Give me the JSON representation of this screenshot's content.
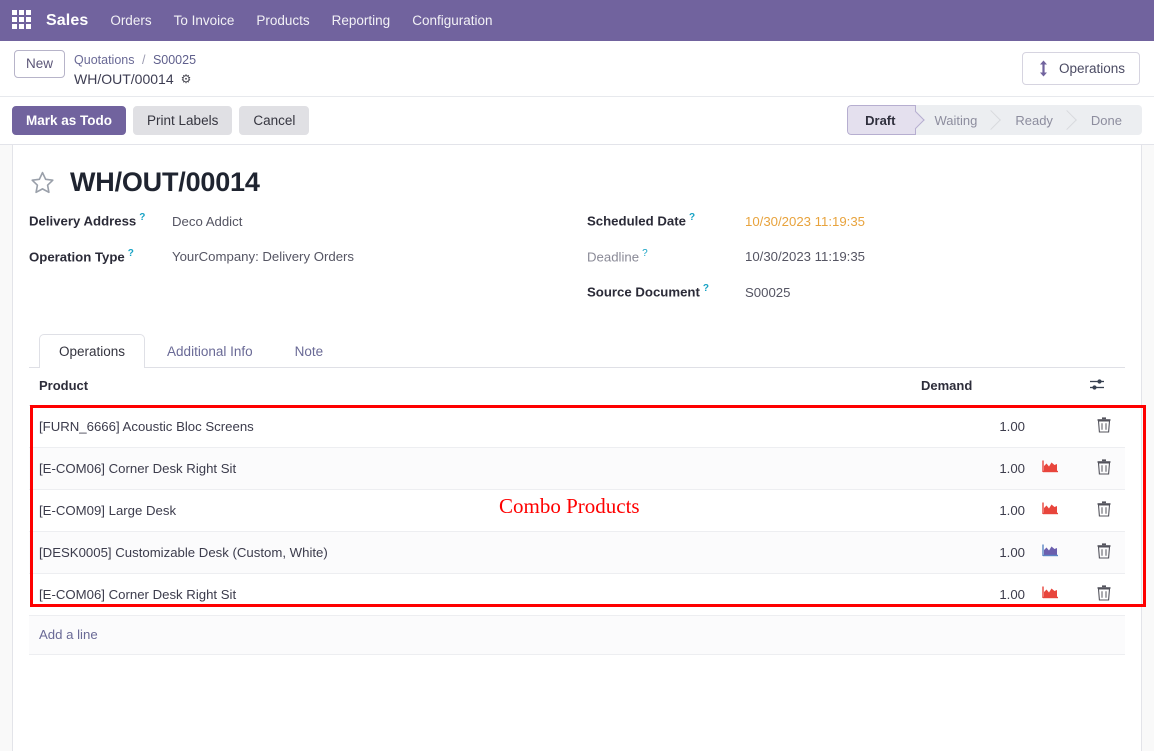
{
  "navbar": {
    "apps_icon": "apps-grid-icon",
    "brand": "Sales",
    "items": [
      {
        "label": "Orders"
      },
      {
        "label": "To Invoice"
      },
      {
        "label": "Products"
      },
      {
        "label": "Reporting"
      },
      {
        "label": "Configuration"
      }
    ]
  },
  "control_panel": {
    "new_label": "New",
    "breadcrumb": {
      "root": "Quotations",
      "separator": "/",
      "parent": "S00025",
      "current": "WH/OUT/00014",
      "gear_icon": "gear-icon"
    },
    "smart_button": {
      "label": "Operations",
      "icon": "arrows-vertical-icon"
    }
  },
  "action_bar": {
    "buttons": [
      {
        "label": "Mark as Todo",
        "style": "primary"
      },
      {
        "label": "Print Labels",
        "style": "secondary"
      },
      {
        "label": "Cancel",
        "style": "secondary"
      }
    ],
    "statusbar": {
      "steps": [
        "Draft",
        "Waiting",
        "Ready",
        "Done"
      ],
      "active": "Draft"
    }
  },
  "record": {
    "star_icon": "star-outline-icon",
    "title": "WH/OUT/00014",
    "fields_left": [
      {
        "label": "Delivery Address",
        "tip": "?",
        "value": "Deco Addict",
        "muted": false,
        "warn": false
      },
      {
        "label": "Operation Type",
        "tip": "?",
        "value": "YourCompany: Delivery Orders",
        "muted": false,
        "warn": false
      }
    ],
    "fields_right": [
      {
        "label": "Scheduled Date",
        "tip": "?",
        "value": "10/30/2023 11:19:35",
        "muted": false,
        "warn": true
      },
      {
        "label": "Deadline",
        "tip": "?",
        "value": "10/30/2023 11:19:35",
        "muted": true,
        "warn": false
      },
      {
        "label": "Source Document",
        "tip": "?",
        "value": "S00025",
        "muted": false,
        "warn": false
      }
    ]
  },
  "notebook": {
    "tabs": [
      {
        "label": "Operations",
        "active": true
      },
      {
        "label": "Additional Info",
        "active": false
      },
      {
        "label": "Note",
        "active": false
      }
    ]
  },
  "lines_table": {
    "columns": {
      "product": "Product",
      "demand": "Demand",
      "forecast": "",
      "trash": "",
      "optional_icon": "sliders-icon"
    },
    "rows": [
      {
        "product": "[FURN_6666] Acoustic Bloc Screens",
        "demand": "1.00",
        "forecast_icon": "none",
        "forecast_color": "",
        "trash_icon": "trash-icon"
      },
      {
        "product": "[E-COM06] Corner Desk Right Sit",
        "demand": "1.00",
        "forecast_icon": "area-chart-icon",
        "forecast_color": "#e8453c",
        "trash_icon": "trash-icon"
      },
      {
        "product": "[E-COM09] Large Desk",
        "demand": "1.00",
        "forecast_icon": "area-chart-icon",
        "forecast_color": "#e8453c",
        "trash_icon": "trash-icon"
      },
      {
        "product": "[DESK0005] Customizable Desk (Custom, White)",
        "demand": "1.00",
        "forecast_icon": "area-chart-icon",
        "forecast_color": "#6b5fae",
        "trash_icon": "trash-icon"
      },
      {
        "product": "[E-COM06] Corner Desk Right Sit",
        "demand": "1.00",
        "forecast_icon": "area-chart-icon",
        "forecast_color": "#e8453c",
        "trash_icon": "trash-icon"
      }
    ],
    "add_line_label": "Add a line"
  },
  "annotations": {
    "combo_note": "Combo Products",
    "highlight_color": "#fe0000"
  },
  "colors": {
    "brand_purple": "#71639e",
    "accent_link": "#6a6a96",
    "warn_orange": "#e8a33d",
    "tip_blue": "#17a2c4"
  }
}
